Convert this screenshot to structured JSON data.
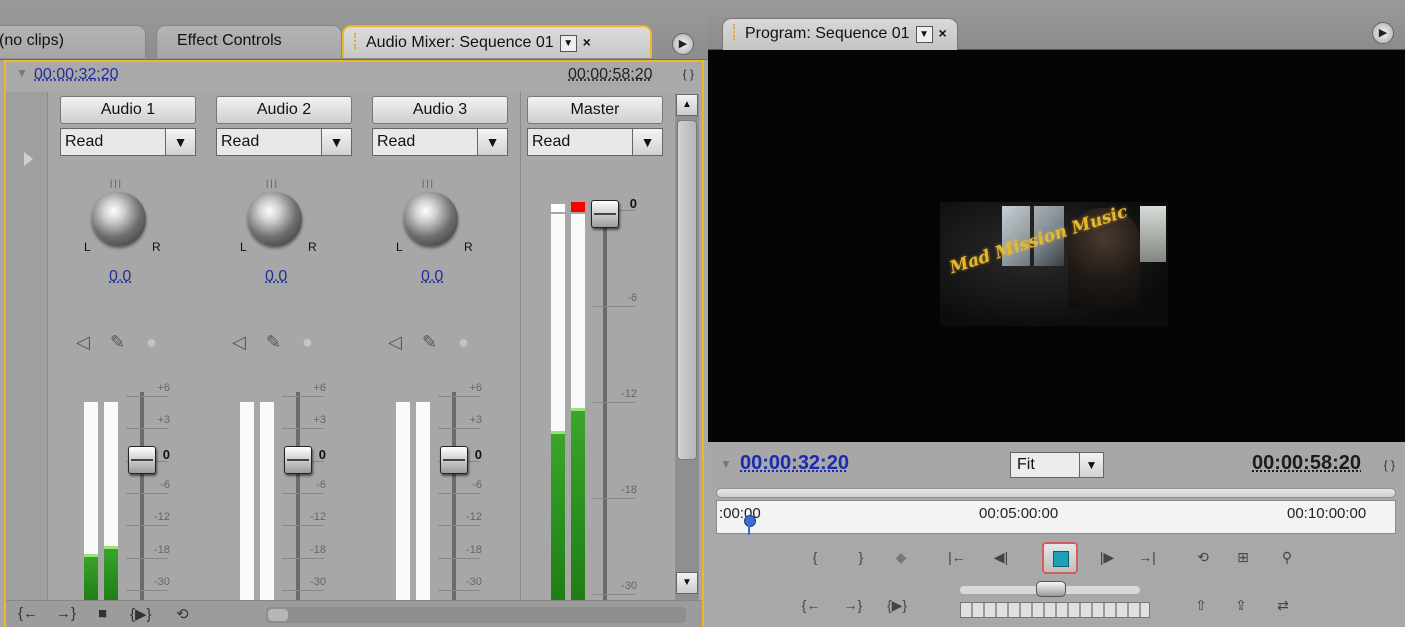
{
  "left_tabs": {
    "source_label": "(no clips)",
    "effect_controls_label": "Effect Controls",
    "audio_mixer_label": "Audio Mixer: Sequence 01",
    "close_glyph": "×",
    "menu_glyph": "▶"
  },
  "mixer": {
    "current_timecode": "00:00:32:20",
    "duration_timecode": "00:00:58:20",
    "tracks": [
      {
        "name": "Audio 1",
        "mode": "Read",
        "pan": "0.0",
        "meter_left": 0.24,
        "meter_right": 0.28
      },
      {
        "name": "Audio 2",
        "mode": "Read",
        "pan": "0.0",
        "meter_left": 0.0,
        "meter_right": 0.0
      },
      {
        "name": "Audio 3",
        "mode": "Read",
        "pan": "0.0",
        "meter_left": 0.0,
        "meter_right": 0.0
      }
    ],
    "master": {
      "name": "Master",
      "mode": "Read",
      "meter_left": 0.44,
      "meter_right": 0.5,
      "clip": true
    },
    "scale_labels": [
      "+6",
      "+3",
      "0",
      "-6",
      "-12",
      "-18",
      "-30"
    ],
    "master_scale_labels": [
      "0",
      "-6",
      "-12",
      "-18",
      "-30"
    ],
    "knob_L": "L",
    "knob_R": "R",
    "dropdown_glyph": "▼"
  },
  "program": {
    "tab_label": "Program: Sequence 01",
    "close_glyph": "×",
    "current_timecode": "00:00:32:20",
    "zoom_option": "Fit",
    "duration_timecode": "00:00:58:20",
    "ruler_labels": [
      ":00:00",
      "00:05:00:00",
      "00:10:00:00"
    ],
    "logo_text": "Mad Mission Music",
    "playhead_position": 0.04
  },
  "colors": {
    "timecode_blue": "#1a2bb3",
    "panel_highlight": "#f0b820",
    "meter_green": "#2e9a22",
    "clip_red": "#ff0000",
    "stop_button_cyan": "#20a0b8"
  }
}
